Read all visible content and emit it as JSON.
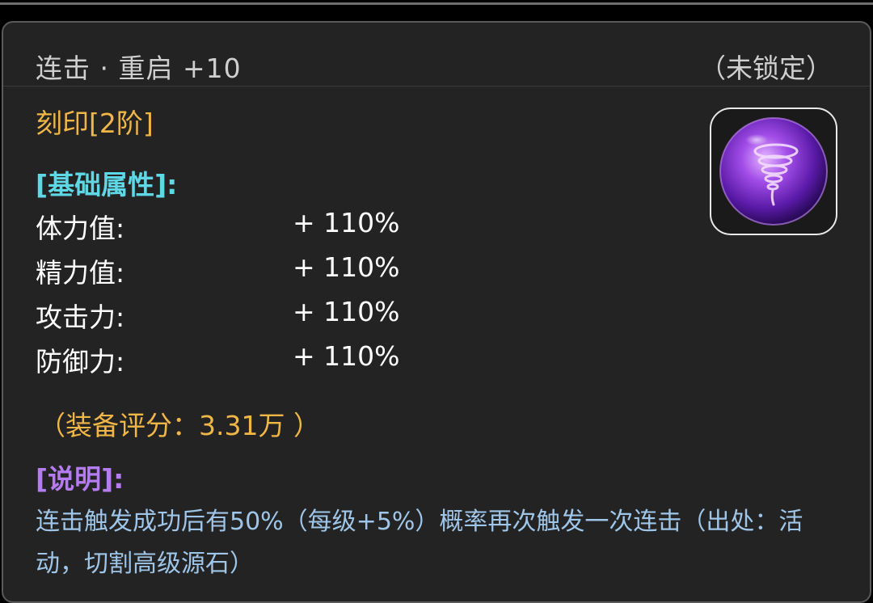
{
  "header": {
    "title": "连击 · 重启 +10",
    "lock_status": "（未锁定）"
  },
  "grade": "刻印[2阶]",
  "item_icon": "purple-tornado-orb-icon",
  "base_attributes": {
    "heading": "[基础属性]:",
    "stats": [
      {
        "label": "体力值:",
        "value": "+ 110%"
      },
      {
        "label": "精力值:",
        "value": "+ 110%"
      },
      {
        "label": "攻击力:",
        "value": "+ 110%"
      },
      {
        "label": "防御力:",
        "value": "+ 110%"
      }
    ]
  },
  "score": "（装备评分：3.31万 ）",
  "description": {
    "heading": "[说明]:",
    "text": "连击触发成功后有50%（每级+5%）概率再次触发一次连击（出处：活动，切割高级源石）"
  },
  "colors": {
    "panel_bg": "#232323",
    "gold": "#f1b746",
    "cyan": "#5fd8e6",
    "purple": "#b57cf0",
    "desc_blue": "#9fc6e8",
    "white": "#ffffff",
    "gray_text": "#cfcfcf"
  }
}
